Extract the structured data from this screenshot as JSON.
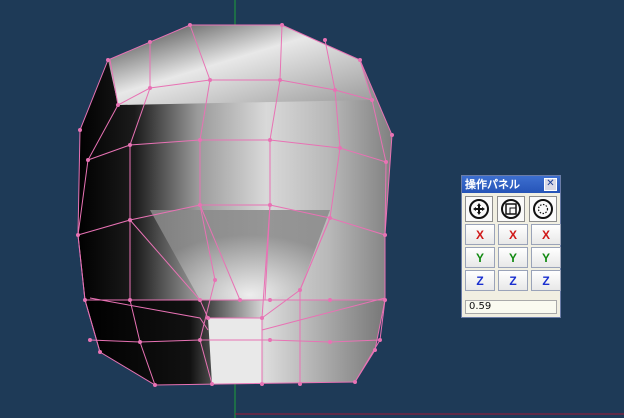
{
  "viewport": {
    "background": "#1e3a57",
    "wire_color": "#e872b4",
    "axis_green": "#1fa03a",
    "axis_red": "#a01a35"
  },
  "panel": {
    "title": "操作パネル",
    "close_label": "✕",
    "modes": [
      {
        "name": "move",
        "icon": "move-arrows-icon"
      },
      {
        "name": "scale",
        "icon": "scale-square-icon"
      },
      {
        "name": "rotate",
        "icon": "rotate-dotted-circle-icon"
      }
    ],
    "axis_rows": [
      {
        "axis": "x",
        "labels": [
          "X",
          "X",
          "X"
        ],
        "color": "#d01818"
      },
      {
        "axis": "y",
        "labels": [
          "Y",
          "Y",
          "Y"
        ],
        "color": "#118a11"
      },
      {
        "axis": "z",
        "labels": [
          "Z",
          "Z",
          "Z"
        ],
        "color": "#1a2fd0"
      }
    ],
    "value": "0.59"
  }
}
